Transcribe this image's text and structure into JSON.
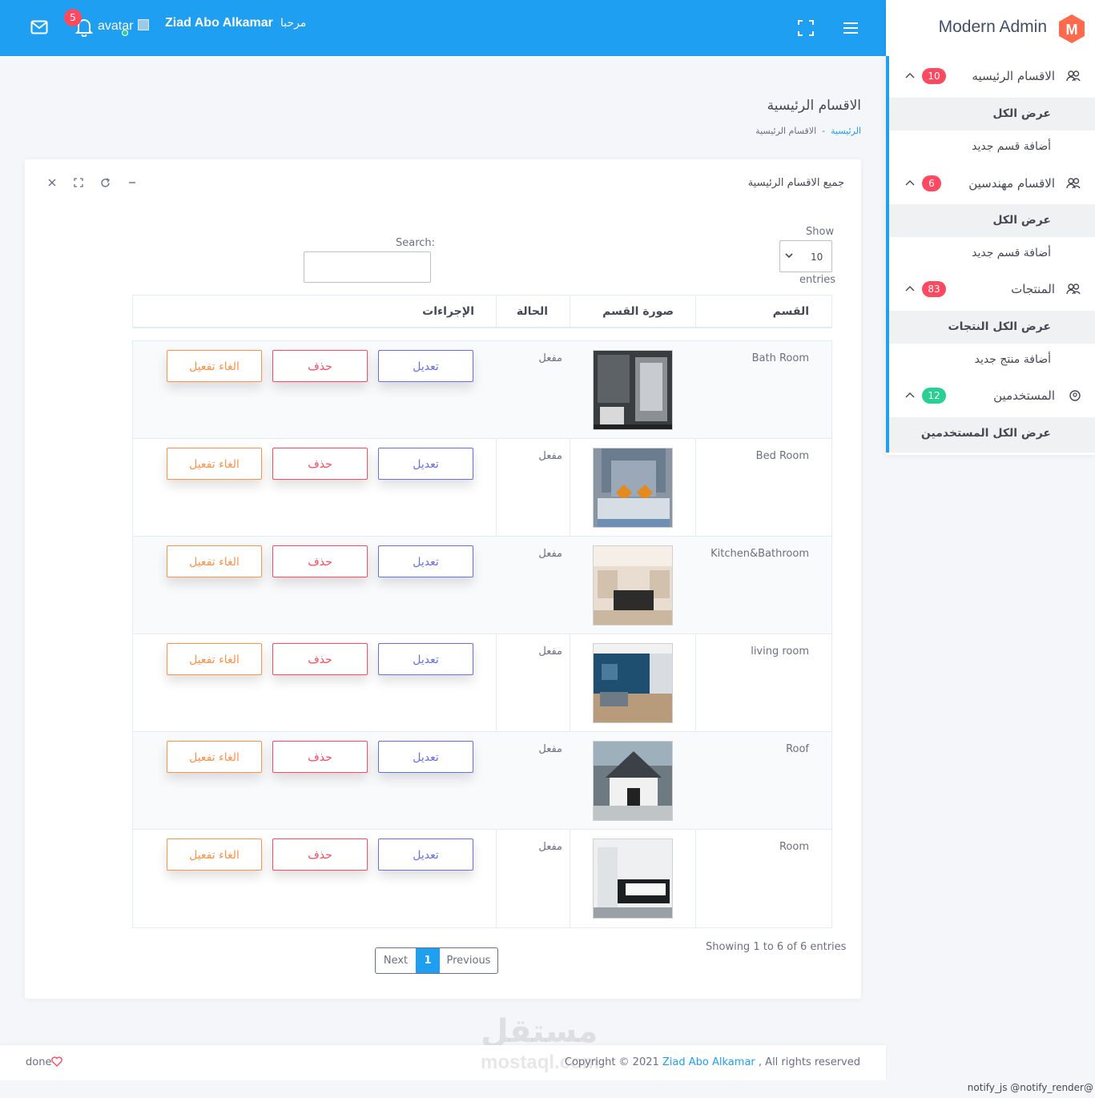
{
  "topbar": {
    "notification_count": "5",
    "avatar_alt": "avatar",
    "user_name": "Ziad Abo Alkamar",
    "greeting": "مرحبا"
  },
  "sidebar": {
    "brand": "Modern Admin",
    "brand_logo_letter": "M",
    "sections": [
      {
        "title": "الاقسام الرئيسيه",
        "count": "10",
        "badge_color": "#ff4961",
        "icon": "people-icon",
        "items": [
          {
            "label": "عرض الكل",
            "active": true
          },
          {
            "label": "أضافة قسم جديد",
            "active": false
          }
        ]
      },
      {
        "title": "الاقسام مهندسين",
        "count": "6",
        "badge_color": "#ff4961",
        "icon": "people-icon",
        "items": [
          {
            "label": "عرض الكل",
            "active": true
          },
          {
            "label": "أضافة قسم جديد",
            "active": false
          }
        ]
      },
      {
        "title": "المنتجات",
        "count": "83",
        "badge_color": "#ff4961",
        "icon": "people-icon",
        "items": [
          {
            "label": "عرض الكل النتجات",
            "active": true
          },
          {
            "label": "أضافة منتج جديد",
            "active": false
          }
        ]
      },
      {
        "title": "المستخدمين",
        "count": "12",
        "badge_color": "#28d094",
        "icon": "user-circle-icon",
        "items": [
          {
            "label": "عرض الكل المستخدمين",
            "active": true
          }
        ]
      }
    ]
  },
  "page": {
    "title": "الاقسام الرئيسية",
    "breadcrumb_home": "الرئيسية",
    "breadcrumb_sep": "-",
    "breadcrumb_current": "الاقسام الرئيسية"
  },
  "card": {
    "title": "جميع الاقسام الرئيسية",
    "show_label": "Show",
    "entries_value": "10",
    "entries_label": "entries",
    "search_label": "Search:",
    "search_value": ""
  },
  "table": {
    "headers": {
      "name": "القسم",
      "image": "صورة القسم",
      "status": "الحالة",
      "actions": "الإجراءات"
    },
    "rows": [
      {
        "name": "Bath Room",
        "status": "مفعل",
        "edit": "تعديل",
        "delete": "حذف",
        "deactivate": "الغاء تفعيل"
      },
      {
        "name": "Bed Room",
        "status": "مفعل",
        "edit": "تعديل",
        "delete": "حذف",
        "deactivate": "الغاء تفعيل"
      },
      {
        "name": "Kitchen&Bathroom",
        "status": "مفعل",
        "edit": "تعديل",
        "delete": "حذف",
        "deactivate": "الغاء تفعيل"
      },
      {
        "name": "living room",
        "status": "مفعل",
        "edit": "تعديل",
        "delete": "حذف",
        "deactivate": "الغاء تفعيل"
      },
      {
        "name": "Roof",
        "status": "مفعل",
        "edit": "تعديل",
        "delete": "حذف",
        "deactivate": "الغاء تفعيل"
      },
      {
        "name": "Room",
        "status": "مفعل",
        "edit": "تعديل",
        "delete": "حذف",
        "deactivate": "الغاء تفعيل"
      }
    ],
    "info": "Showing 1 to 6 of 6 entries",
    "pager": {
      "next": "Next",
      "current": "1",
      "previous": "Previous"
    }
  },
  "footer": {
    "done": "done",
    "copyright": "Copyright © 2021",
    "owner": "Ziad Abo Alkamar",
    "rights": ", All rights reserved",
    "notify": "notify_js @notify_render@"
  },
  "watermark": {
    "arabic": "مستقل",
    "latin": "mostaql.com"
  },
  "colors": {
    "primary": "#1e9ff2",
    "danger": "#ff4961",
    "success": "#28d094",
    "edit": "#666ee8",
    "warning": "#ff9149"
  }
}
